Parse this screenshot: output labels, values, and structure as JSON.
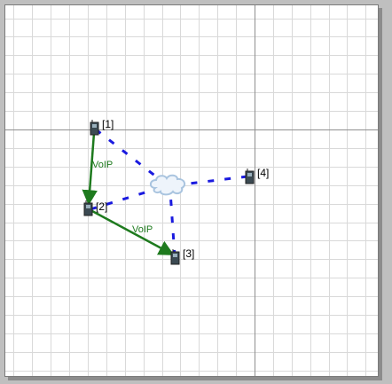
{
  "colors": {
    "grid_minor": "#d9d9d9",
    "grid_axis": "#8f8f8f",
    "wireless": "#1a1adf",
    "voip": "#1e7a1e",
    "node_body": "#3b4a52",
    "cloud": "#a9c4df"
  },
  "nodes": [
    {
      "id": "1",
      "label": "[1]",
      "icon": "phone-icon"
    },
    {
      "id": "2",
      "label": "[2]",
      "icon": "phone-icon"
    },
    {
      "id": "3",
      "label": "[3]",
      "icon": "phone-icon"
    },
    {
      "id": "4",
      "label": "[4]",
      "icon": "phone-icon"
    }
  ],
  "access_point": {
    "icon": "cloud-icon"
  },
  "flows": [
    {
      "from": "1",
      "to": "2",
      "label": "VoIP"
    },
    {
      "from": "2",
      "to": "3",
      "label": "VoIP"
    }
  ]
}
